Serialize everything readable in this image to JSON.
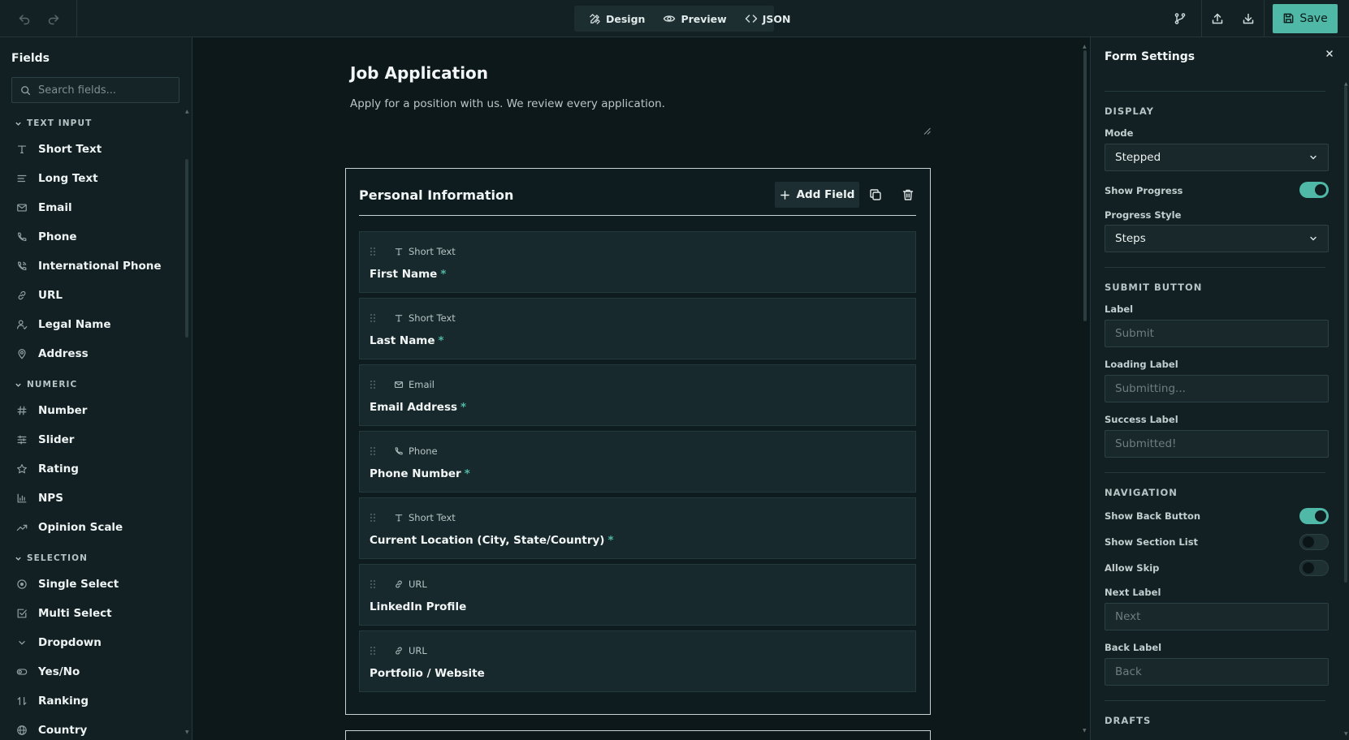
{
  "toolbar": {
    "tabs": [
      {
        "label": "Design",
        "icon": "design-icon"
      },
      {
        "label": "Preview",
        "icon": "eye-icon"
      },
      {
        "label": "JSON",
        "icon": "code-icon"
      }
    ],
    "save_label": "Save"
  },
  "sidebar": {
    "title": "Fields",
    "search_placeholder": "Search fields...",
    "categories": [
      {
        "label": "TEXT INPUT",
        "items": [
          {
            "label": "Short Text",
            "icon": "text-t-icon"
          },
          {
            "label": "Long Text",
            "icon": "align-left-icon"
          },
          {
            "label": "Email",
            "icon": "mail-icon"
          },
          {
            "label": "Phone",
            "icon": "phone-icon"
          },
          {
            "label": "International Phone",
            "icon": "phone-international-icon"
          },
          {
            "label": "URL",
            "icon": "link-icon"
          },
          {
            "label": "Legal Name",
            "icon": "user-icon"
          },
          {
            "label": "Address",
            "icon": "map-pin-icon"
          }
        ]
      },
      {
        "label": "NUMERIC",
        "items": [
          {
            "label": "Number",
            "icon": "hash-icon"
          },
          {
            "label": "Slider",
            "icon": "sliders-icon"
          },
          {
            "label": "Rating",
            "icon": "star-icon"
          },
          {
            "label": "NPS",
            "icon": "bar-chart-icon"
          },
          {
            "label": "Opinion Scale",
            "icon": "trending-up-icon"
          }
        ]
      },
      {
        "label": "SELECTION",
        "items": [
          {
            "label": "Single Select",
            "icon": "radio-icon"
          },
          {
            "label": "Multi Select",
            "icon": "checkbox-icon"
          },
          {
            "label": "Dropdown",
            "icon": "chevron-down-icon"
          },
          {
            "label": "Yes/No",
            "icon": "toggle-icon"
          },
          {
            "label": "Ranking",
            "icon": "arrows-up-down-icon"
          },
          {
            "label": "Country",
            "icon": "globe-icon"
          }
        ]
      }
    ]
  },
  "form": {
    "title": "Job Application",
    "description": "Apply for a position with us. We review every application.",
    "section": {
      "title": "Personal Information",
      "add_field_label": "Add Field",
      "fields": [
        {
          "type": "Short Text",
          "icon": "text-t-icon",
          "label": "First Name",
          "required": "*"
        },
        {
          "type": "Short Text",
          "icon": "text-t-icon",
          "label": "Last Name",
          "required": "*"
        },
        {
          "type": "Email",
          "icon": "mail-icon",
          "label": "Email Address",
          "required": "*"
        },
        {
          "type": "Phone",
          "icon": "phone-icon",
          "label": "Phone Number",
          "required": "*"
        },
        {
          "type": "Short Text",
          "icon": "text-t-icon",
          "label": "Current Location (City, State/Country)",
          "required": "*"
        },
        {
          "type": "URL",
          "icon": "link-icon",
          "label": "LinkedIn Profile",
          "required": ""
        },
        {
          "type": "URL",
          "icon": "link-icon",
          "label": "Portfolio / Website",
          "required": ""
        }
      ]
    }
  },
  "settings": {
    "title": "Form Settings",
    "display": {
      "heading": "DISPLAY",
      "mode_label": "Mode",
      "mode_value": "Stepped",
      "show_progress_label": "Show Progress",
      "show_progress": true,
      "progress_style_label": "Progress Style",
      "progress_style_value": "Steps"
    },
    "submit": {
      "heading": "SUBMIT BUTTON",
      "label_label": "Label",
      "label_placeholder": "Submit",
      "loading_label": "Loading Label",
      "loading_placeholder": "Submitting...",
      "success_label": "Success Label",
      "success_placeholder": "Submitted!"
    },
    "navigation": {
      "heading": "NAVIGATION",
      "show_back_label": "Show Back Button",
      "show_back": true,
      "show_section_list_label": "Show Section List",
      "show_section_list": false,
      "allow_skip_label": "Allow Skip",
      "allow_skip": false,
      "next_label": "Next Label",
      "next_placeholder": "Next",
      "back_label": "Back Label",
      "back_placeholder": "Back"
    },
    "drafts": {
      "heading": "DRAFTS"
    }
  },
  "colors": {
    "accent": "#4fb8a6",
    "background": "#0e1a1d",
    "panel": "#122023"
  }
}
